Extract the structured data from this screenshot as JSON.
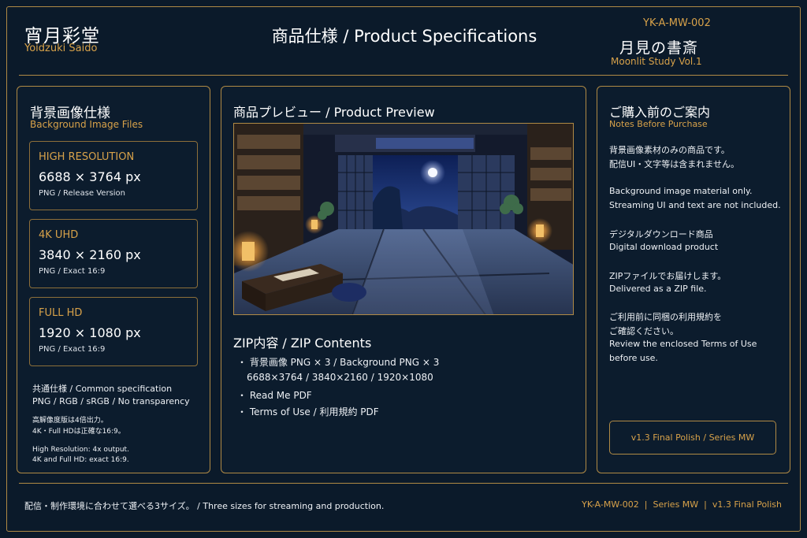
{
  "header": {
    "brand_jp": "宵月彩堂",
    "brand_en": "Yoidzuki Saido",
    "title": "商品仕様 / Product Specifications",
    "product_code": "YK-A-MW-002",
    "product_jp": "月見の書斎",
    "product_en": "Moonlit Study Vol.1"
  },
  "left_panel": {
    "title": "背景画像仕様",
    "subtitle": "Background Image Files",
    "specs": [
      {
        "label": "HIGH RESOLUTION",
        "value": "6688 × 3764 px",
        "note": "PNG / Release Version"
      },
      {
        "label": "4K UHD",
        "value": "3840 × 2160 px",
        "note": "PNG / Exact 16:9"
      },
      {
        "label": "FULL HD",
        "value": "1920 × 1080 px",
        "note": "PNG / Exact 16:9"
      }
    ],
    "common_title": "共通仕様 / Common specification",
    "common_format": "PNG / RGB / sRGB / No transparency",
    "common_notes": [
      "高解像度版は4倍出力。",
      "4K・Full HDは正確な16:9。",
      "High Resolution: 4x output.",
      "4K and Full HD: exact 16:9."
    ]
  },
  "center_panel": {
    "title": "商品プレビュー / Product Preview",
    "zip_title": "ZIP内容 / ZIP Contents",
    "zip_items": [
      "・ 背景画像 PNG × 3 / Background PNG × 3",
      "6688×3764 / 3840×2160 / 1920×1080",
      "・ Read Me PDF",
      "・ Terms of Use / 利用規約 PDF"
    ]
  },
  "right_panel": {
    "title": "ご購入前のご案内",
    "subtitle": "Notes Before Purchase",
    "notes": [
      "背景画像素材のみの商品です。",
      "配信UI・文字等は含まれません。",
      "Background image material only.",
      "Streaming UI and text are not included.",
      "デジタルダウンロード商品",
      "Digital download product",
      "ZIPファイルでお届けします。",
      "Delivered as a ZIP file.",
      "ご利用前に同梱の利用規約を",
      "ご確認ください。",
      "Review the enclosed Terms of Use",
      "before use."
    ],
    "version_label": "v1.3 Final Polish / Series MW"
  },
  "footer": {
    "left": "配信・制作環境に合わせて選べる3サイズ。 / Three sizes for streaming and production.",
    "right": "YK-A-MW-002  |  Series MW  |  v1.3 Final Polish"
  },
  "colors": {
    "background": "#0b1a2a",
    "accent_gold": "#d8a24a",
    "border_gold": "#b08a45",
    "text": "#ffffff"
  }
}
